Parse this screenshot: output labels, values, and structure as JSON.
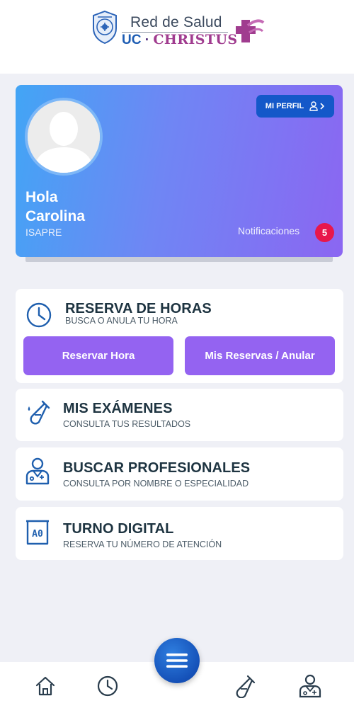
{
  "header": {
    "logo": {
      "line1": "Red de Salud",
      "uc": "UC",
      "dot": "·",
      "christus": "CHRISTUS"
    }
  },
  "profile": {
    "button_label": "MI PERFIL",
    "greeting_line1": "Hola",
    "greeting_line2": "Carolina",
    "insurance": "ISAPRE",
    "notifications_label": "Notificaciones",
    "notifications_count": "5"
  },
  "cards": [
    {
      "title": "RESERVA DE HORAS",
      "subtitle": "BUSCA O ANULA TU HORA",
      "icon": "clock-icon",
      "buttons": [
        "Reservar Hora",
        "Mis Reservas / Anular"
      ]
    },
    {
      "title": "MIS EXÁMENES",
      "subtitle": "CONSULTA TUS RESULTADOS",
      "icon": "test-tube-icon"
    },
    {
      "title": "BUSCAR PROFESIONALES",
      "subtitle": "CONSULTA POR NOMBRE O ESPECIALIDAD",
      "icon": "doctor-icon"
    },
    {
      "title": "TURNO DIGITAL",
      "subtitle": "RESERVA TU NÚMERO DE ATENCIÓN",
      "icon": "ticket-icon",
      "ticket_text": "A0"
    }
  ],
  "bottom_nav": {
    "items": [
      "home-icon",
      "clock-icon",
      "menu-icon",
      "test-tube-icon",
      "doctor-icon"
    ]
  },
  "colors": {
    "accent": "#9463f1",
    "primary": "#1458c9",
    "badge": "#e8174b",
    "icon": "#1f5fae"
  }
}
